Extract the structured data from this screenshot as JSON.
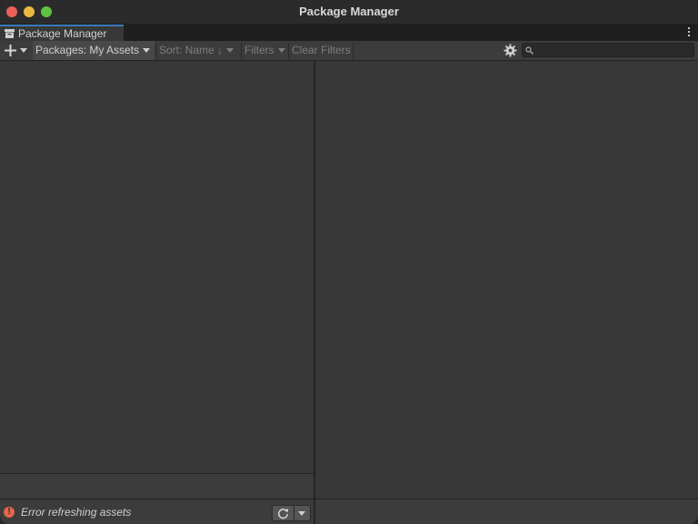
{
  "window": {
    "title": "Package Manager"
  },
  "tab": {
    "label": "Package Manager",
    "icon": "package-icon"
  },
  "toolbar": {
    "add_icon": "plus-icon",
    "packages_label": "Packages: My Assets",
    "sort_label": "Sort: Name ↓",
    "filters_label": "Filters",
    "clear_filters_label": "Clear Filters",
    "settings_icon": "gear-icon",
    "search_placeholder": ""
  },
  "status": {
    "message": "Error refreshing assets",
    "icon": "error-icon",
    "refresh_icon": "refresh-icon"
  },
  "colors": {
    "accent": "#3a79bb",
    "error": "#e2664a"
  }
}
